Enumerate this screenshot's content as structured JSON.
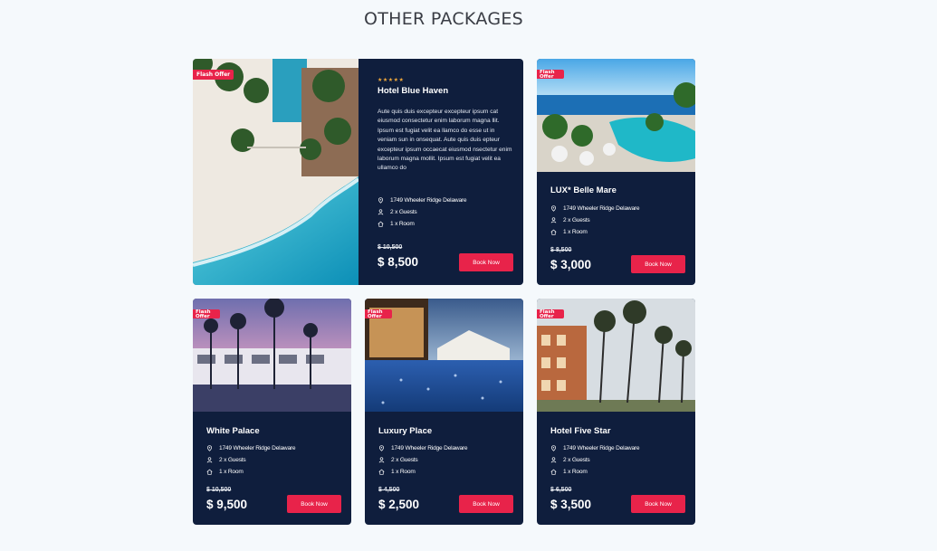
{
  "section_title": "OTHER PACKAGES",
  "badge_label": "Flash Offer",
  "book_label": "Book Now",
  "colors": {
    "card_bg": "#0f1e3d",
    "accent": "#e8234a",
    "page_bg": "#f5f9fc",
    "stars": "#f2a93b"
  },
  "icons": {
    "location": "location-pin-icon",
    "guests": "user-icon",
    "room": "home-icon"
  },
  "featured": {
    "stars": "★★★★★",
    "name": "Hotel Blue Haven",
    "description": "Aute quis duis excepteur excepteur ipsum cat eiusmod consectetur enim laborum magna llit. Ipsum est fugiat velit ea llamco do esse ut in veniam sun in onsequat. Aute quis duis epteur excepteur ipsum occaecat eiusmod nsectetur enim laborum magna mollit. Ipsum est fugiat velit ea ullamco do",
    "address": "1749 Wheeler Ridge Delaware",
    "guests": "2 x Guests",
    "rooms": "1 x Room",
    "old_price": "$ 10,500",
    "price": "$ 8,500"
  },
  "cards": [
    {
      "name": "LUX* Belle Mare",
      "address": "1749 Wheeler Ridge Delaware",
      "guests": "2 x Guests",
      "rooms": "1 x Room",
      "old_price": "$ 8,500",
      "price": "$ 3,000"
    },
    {
      "name": "White Palace",
      "address": "1749 Wheeler Ridge Delaware",
      "guests": "2 x Guests",
      "rooms": "1 x Room",
      "old_price": "$ 10,500",
      "price": "$ 9,500"
    },
    {
      "name": "Luxury Place",
      "address": "1749 Wheeler Ridge Delaware",
      "guests": "2 x Guests",
      "rooms": "1 x Room",
      "old_price": "$ 4,500",
      "price": "$ 2,500"
    },
    {
      "name": "Hotel Five Star",
      "address": "1749 Wheeler Ridge Delaware",
      "guests": "2 x Guests",
      "rooms": "1 x Room",
      "old_price": "$ 6,500",
      "price": "$ 3,500"
    }
  ]
}
